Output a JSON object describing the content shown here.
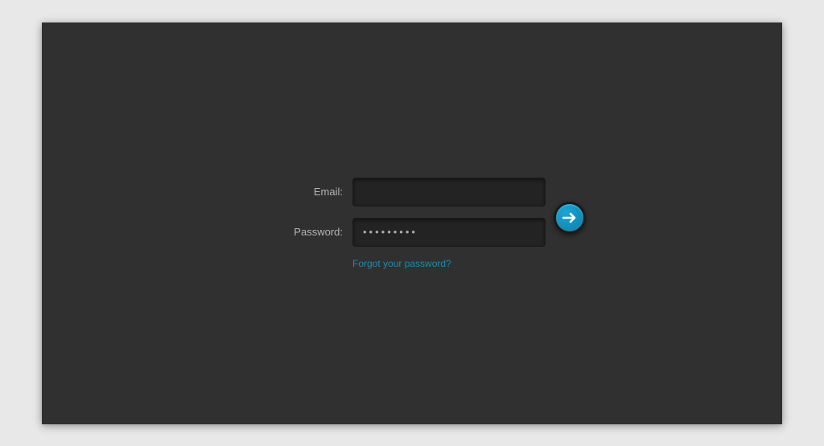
{
  "login": {
    "email_label": "Email:",
    "password_label": "Password:",
    "email_value": "",
    "password_value": "•••••••••",
    "forgot_link": "Forgot your password?",
    "submit_icon": "arrow-right"
  }
}
